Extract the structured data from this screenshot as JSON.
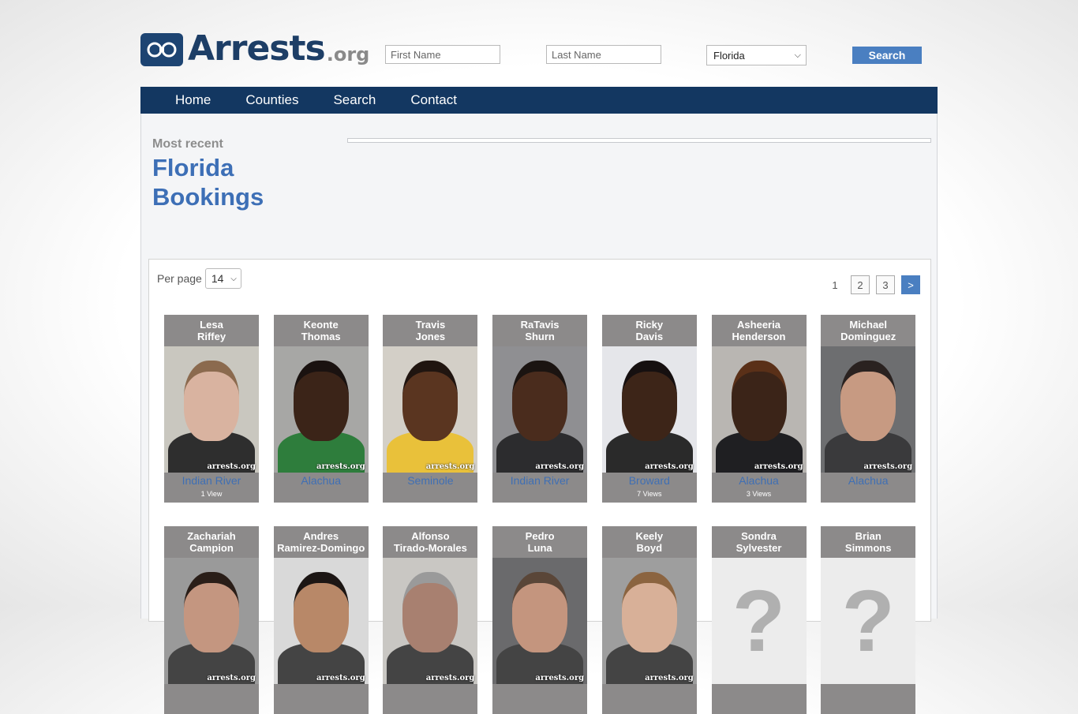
{
  "site": {
    "name_main": "Arrests",
    "name_tld": ".org"
  },
  "search": {
    "first_placeholder": "First Name",
    "last_placeholder": "Last Name",
    "state_value": "Florida",
    "button_label": "Search"
  },
  "nav": {
    "items": [
      "Home",
      "Counties",
      "Search",
      "Contact"
    ]
  },
  "intro": {
    "kicker": "Most recent",
    "title_line1": "Florida",
    "title_line2": "Bookings"
  },
  "listing": {
    "per_page_label": "Per page",
    "per_page_value": "14",
    "pages": [
      "1",
      "2",
      "3",
      ">"
    ]
  },
  "watermark": "arrests.org",
  "people": [
    {
      "first": "Lesa",
      "last": "Riffey",
      "county": "Indian River",
      "views": "1 View",
      "skin": "#d9b3a0",
      "hair": "#8b6a4e",
      "shirt": "#2e2e2e",
      "bg": "#c9c7bf"
    },
    {
      "first": "Keonte",
      "last": "Thomas",
      "county": "Alachua",
      "views": "",
      "skin": "#3b2418",
      "hair": "#1a1210",
      "shirt": "#2e7d3c",
      "bg": "#a7a7a5"
    },
    {
      "first": "Travis",
      "last": "Jones",
      "county": "Seminole",
      "views": "",
      "skin": "#5a3520",
      "hair": "#201510",
      "shirt": "#e9c13a",
      "bg": "#d3cfc7"
    },
    {
      "first": "RaTavis",
      "last": "Shurn",
      "county": "Indian River",
      "views": "",
      "skin": "#4a2c1d",
      "hair": "#1b1411",
      "shirt": "#2c2c2e",
      "bg": "#8f8f92"
    },
    {
      "first": "Ricky",
      "last": "Davis",
      "county": "Broward",
      "views": "7 Views",
      "skin": "#3d2518",
      "hair": "#161010",
      "shirt": "#2a2a2a",
      "bg": "#e5e6ea"
    },
    {
      "first": "Asheeria",
      "last": "Henderson",
      "county": "Alachua",
      "views": "3 Views",
      "skin": "#3b2418",
      "hair": "#5a3018",
      "shirt": "#1f1f22",
      "bg": "#b9b6b2"
    },
    {
      "first": "Michael",
      "last": "Dominguez",
      "county": "Alachua",
      "views": "",
      "skin": "#c79a82",
      "hair": "#2a2220",
      "shirt": "#3a3a3c",
      "bg": "#6d6e70"
    },
    {
      "first": "Zachariah",
      "last": "Campion",
      "county": "",
      "views": "",
      "skin": "#c49680",
      "hair": "#2a1e18",
      "shirt": "#444",
      "bg": "#9a9a9a"
    },
    {
      "first": "Andres",
      "last": "Ramirez-Domingo",
      "county": "",
      "views": "",
      "skin": "#b88868",
      "hair": "#1c1614",
      "shirt": "#444",
      "bg": "#d9d9d9"
    },
    {
      "first": "Alfonso",
      "last": "Tirado-Morales",
      "county": "",
      "views": "",
      "skin": "#a88070",
      "hair": "#9a9a9a",
      "shirt": "#444",
      "bg": "#c9c7c3"
    },
    {
      "first": "Pedro",
      "last": "Luna",
      "county": "",
      "views": "",
      "skin": "#c4957e",
      "hair": "#5a4638",
      "shirt": "#444",
      "bg": "#6a6a6c"
    },
    {
      "first": "Keely",
      "last": "Boyd",
      "county": "",
      "views": "",
      "skin": "#d8b098",
      "hair": "#8b6440",
      "shirt": "#444",
      "bg": "#9e9e9e"
    },
    {
      "first": "Sondra",
      "last": "Sylvester",
      "county": "",
      "views": "",
      "placeholder": true,
      "skin": "",
      "hair": "",
      "shirt": "",
      "bg": ""
    },
    {
      "first": "Brian",
      "last": "Simmons",
      "county": "",
      "views": "",
      "placeholder": true,
      "skin": "",
      "hair": "",
      "shirt": "",
      "bg": ""
    }
  ]
}
